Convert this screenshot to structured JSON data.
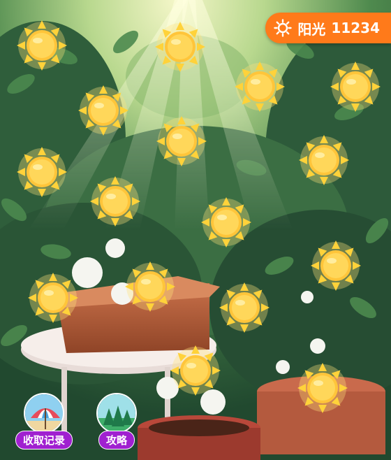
{
  "hud": {
    "label": "阳光",
    "value": "11234",
    "icon": "sun-icon",
    "bg_color": "#ff7a1a"
  },
  "suns": [
    {
      "name": "sun-1"
    },
    {
      "name": "sun-2"
    },
    {
      "name": "sun-3"
    },
    {
      "name": "sun-4"
    },
    {
      "name": "sun-5"
    },
    {
      "name": "sun-6"
    },
    {
      "name": "sun-7"
    },
    {
      "name": "sun-8"
    },
    {
      "name": "sun-9"
    },
    {
      "name": "sun-10"
    },
    {
      "name": "sun-11"
    },
    {
      "name": "sun-12"
    },
    {
      "name": "sun-13"
    },
    {
      "name": "sun-14"
    },
    {
      "name": "sun-15"
    },
    {
      "name": "sun-16"
    },
    {
      "name": "sun-17"
    },
    {
      "name": "sun-18"
    }
  ],
  "buttons": {
    "records_label": "收取记录",
    "records_icon": "beach-umbrella-icon",
    "guide_label": "攻略",
    "guide_icon": "forest-icon",
    "label_color": "#a020d0"
  }
}
